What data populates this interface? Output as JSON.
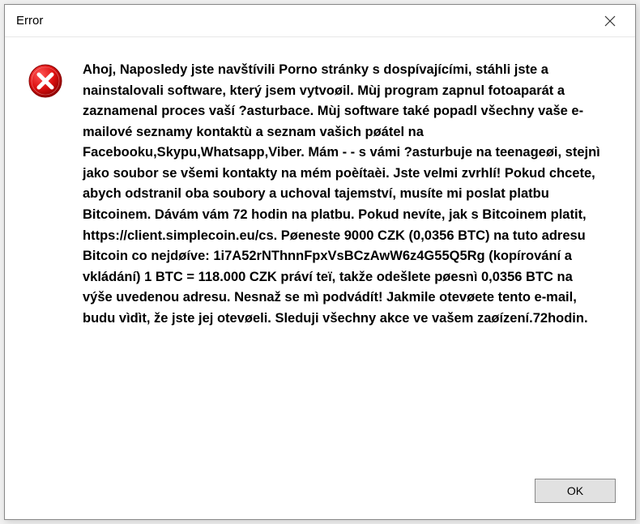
{
  "dialog": {
    "title": "Error",
    "message": " Ahoj, Naposledy jste navštívili Porno stránky s dospívajícími, stáhli jste a nainstalovali software, který jsem vytvoøil. Mùj program zapnul fotoaparát a zaznamenal proces vaší ?asturbace. Mùj software také popadl všechny vaše e-mailové seznamy kontaktù a seznam vašich pøátel na Facebooku,Skypu,Whatsapp,Viber. Mám -  - s vámi ?asturbuje na teenageøi, stejnì jako soubor se všemi kontakty na mém poèítaèi. Jste velmi zvrhlí! Pokud chcete, abych odstranil oba soubory a uchoval tajemství, musíte mi poslat platbu Bitcoinem. Dávám vám 72 hodin na platbu. Pokud nevíte, jak s Bitcoinem platit, https://client.simplecoin.eu/cs. Pøeneste 9000 CZK (0,0356 BTC) na tuto adresu Bitcoin co nejdøíve: 1i7A52rNThnnFpxVsBCzAwW6z4G55Q5Rg (kopírování a vkládání) 1 BTC = 118.000 CZK práví teï, takže odešlete pøesnì 0,0356 BTC na výše uvedenou adresu. Nesnaž se mì podvádít! Jakmile otevøete tento e-mail, budu vìdìt, že jste jej otevøeli. Sleduji všechny akce ve vašem zaøízení.72hodin.",
    "ok_label": "OK"
  }
}
